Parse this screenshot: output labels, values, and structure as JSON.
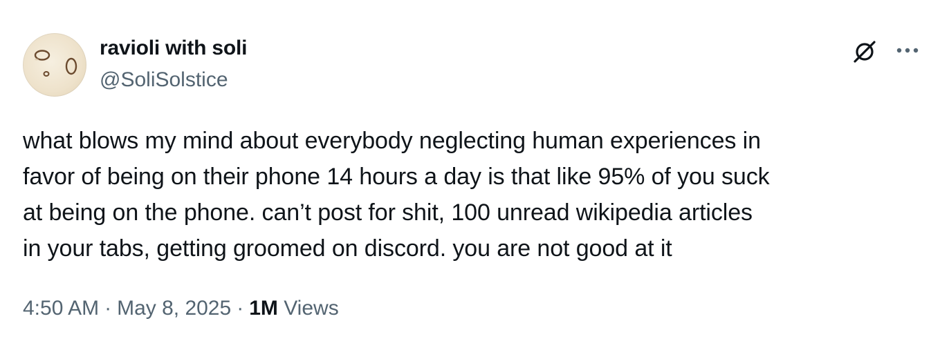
{
  "author": {
    "display_name": "ravioli with soli",
    "handle": "@SoliSolstice",
    "avatar_icon": "ravioli-avatar-icon"
  },
  "tweet": {
    "lines": [
      "what blows my mind about everybody neglecting human experiences in",
      "favor of being on their phone 14 hours a day is that like 95% of you suck",
      "at being on the phone. can’t post for shit, 100 unread wikipedia articles",
      "in your tabs, getting groomed on discord. you are not good at it"
    ]
  },
  "meta": {
    "time": "4:50 AM",
    "separator": "·",
    "date": "May 8, 2025",
    "views_count": "1M",
    "views_label": "Views"
  },
  "header_actions": {
    "grok_icon": "grok-icon",
    "more_icon": "more-options-icon"
  },
  "colors": {
    "text_primary": "#0f1419",
    "text_secondary": "#536471",
    "background": "#ffffff"
  }
}
